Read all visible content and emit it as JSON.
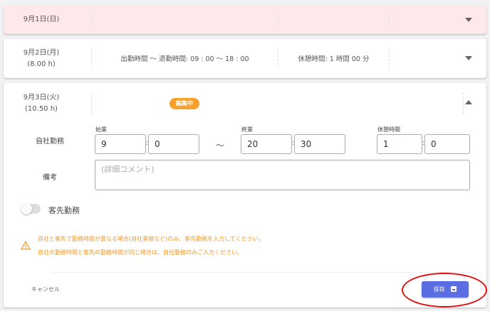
{
  "days": [
    {
      "date": "9月1日(日)",
      "hours": "",
      "work_time": "",
      "break_time": "",
      "expanded": false,
      "holiday": true
    },
    {
      "date": "9月2日(月)",
      "hours": "(8.00 h)",
      "work_time": "出勤時間 〜 退勤時間: 09 : 00 〜 18 : 00",
      "break_time": "休憩時間: 1 時間 00 分",
      "expanded": false
    },
    {
      "date": "9月3日(火)",
      "hours": "(10.50 h)",
      "badge": "編集中",
      "expanded": true
    }
  ],
  "form": {
    "own_work_label": "自社勤務",
    "start_label": "始業",
    "end_label": "終業",
    "break_label": "休憩時間",
    "start_hour": "9",
    "start_min": "0",
    "tilde": "〜",
    "end_hour": "20",
    "end_min": "30",
    "break_hour": "1",
    "break_min": "0",
    "colon": ":",
    "note_label": "備考",
    "note_placeholder": "(詳細コメント)",
    "note_value": "",
    "client_toggle_label": "客先勤務",
    "client_toggle_on": false,
    "warning_lines": [
      "自社と客先で勤務時間が異なる場合(自社業務など)のみ、客先勤務を入力してください。",
      "自社の勤務時間と客先の勤務時間が同じ場合は、自社勤務のみご入力ください。"
    ],
    "cancel_label": "キャンセル",
    "save_label": "保存"
  },
  "colors": {
    "holiday_bg": "#fde8ea",
    "badge": "#f7a12b",
    "warning": "#f09a2a",
    "save": "#5b6ee1",
    "highlight": "#e01010"
  }
}
